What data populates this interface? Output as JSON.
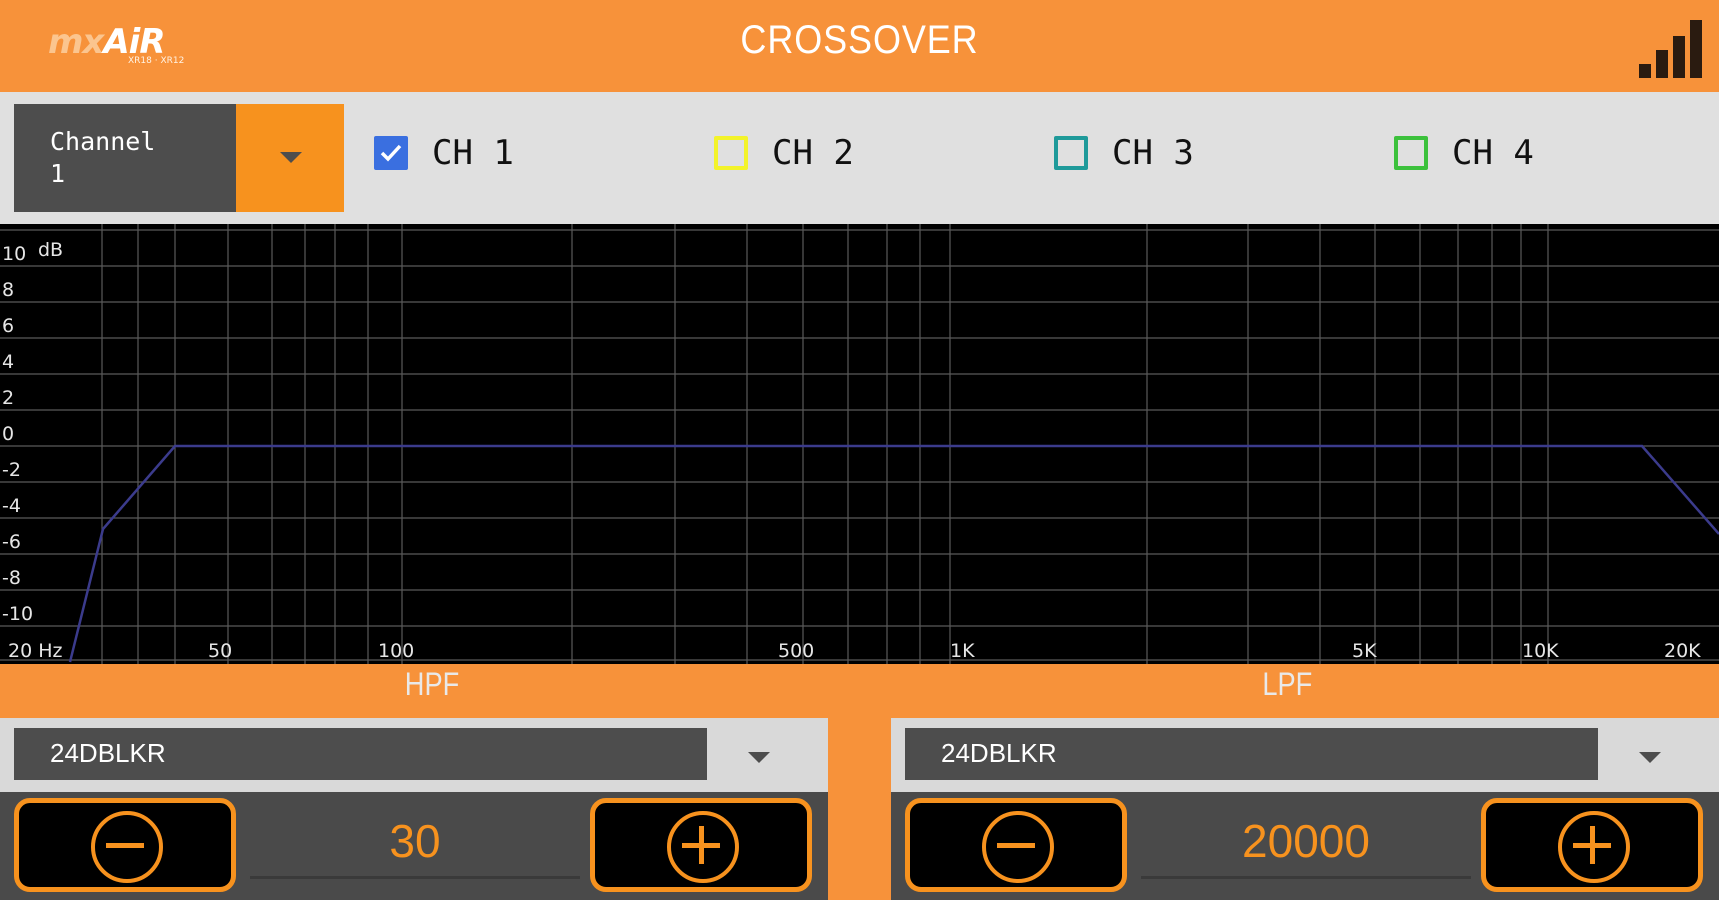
{
  "header": {
    "logo_mx": "mx",
    "logo_air": "AiR",
    "logo_sub": "XR18 · XR12",
    "title": "CROSSOVER",
    "signal_icon": "signal-bars-icon"
  },
  "toolbar": {
    "channel_select": {
      "line1": "Channel",
      "line2": "1"
    },
    "channels": [
      {
        "label": "CH 1",
        "checked": true,
        "color": "#3a6fe0"
      },
      {
        "label": "CH 2",
        "checked": false,
        "color": "#f3f32a"
      },
      {
        "label": "CH 3",
        "checked": false,
        "color": "#1f9a9a"
      },
      {
        "label": "CH 4",
        "checked": false,
        "color": "#3cc13c"
      }
    ]
  },
  "graph": {
    "db_unit": "dB",
    "y_labels": [
      "10",
      "8",
      "6",
      "4",
      "2",
      "0",
      "-2",
      "-4",
      "-6",
      "-8",
      "-10"
    ],
    "x_labels": [
      "20 Hz",
      "50",
      "100",
      "500",
      "1K",
      "5K",
      "10K",
      "20K"
    ],
    "curve_color": "#3b3b8c"
  },
  "hpf": {
    "label": "HPF",
    "type": "24DBLKR",
    "value": "30"
  },
  "lpf": {
    "label": "LPF",
    "type": "24DBLKR",
    "value": "20000"
  },
  "colors": {
    "accent": "#f7923a",
    "button_border": "#f7921e"
  }
}
